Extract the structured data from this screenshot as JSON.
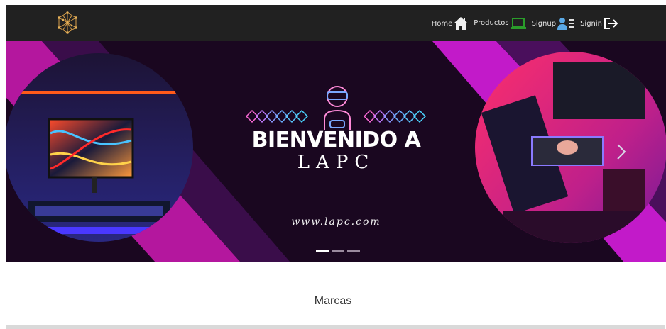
{
  "nav": {
    "home_label": "Home",
    "productos_label": "Productos",
    "signup_label": "Signup",
    "signin_label": "Signin"
  },
  "hero": {
    "headline": "BIENVENIDO A",
    "brand": "LAPC",
    "url": "www.lapc.com",
    "slide_count": 3,
    "active_slide": 1
  },
  "colors": {
    "navbar_bg": "#212121",
    "hero_bg": "#1a0720",
    "magenta_accent": "#c21ac9",
    "productos_icon": "#2a9d2a",
    "signup_icon": "#5aa9e6"
  },
  "section": {
    "title": "Marcas"
  }
}
